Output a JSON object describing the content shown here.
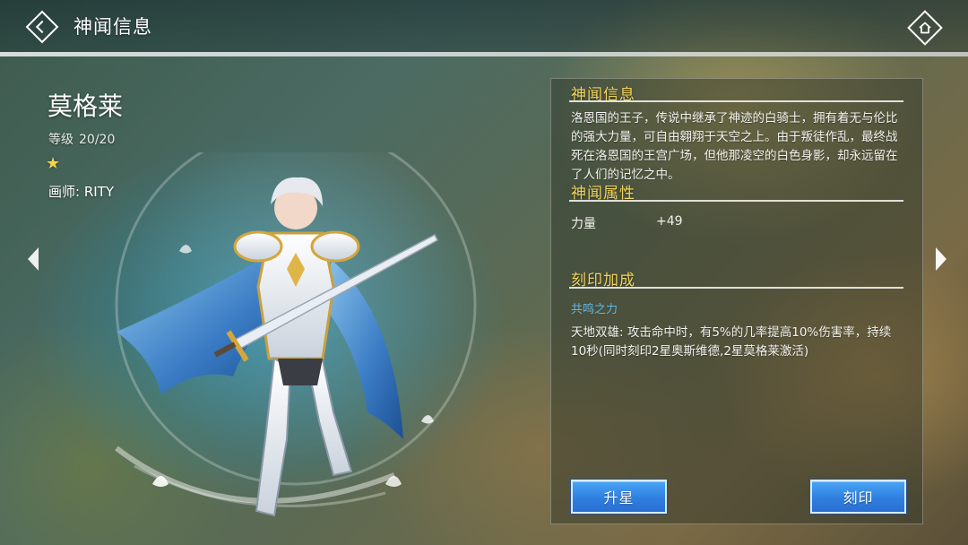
{
  "header": {
    "title": "神闻信息",
    "back_icon": "diamond-back-icon",
    "home_icon": "diamond-home-icon"
  },
  "hero": {
    "name": "莫格莱",
    "level_label": "等级",
    "level_value": "20/20",
    "stars": 1,
    "star_glyph": "★",
    "artist": "画师: RITY"
  },
  "panel": {
    "info": {
      "title": "神闻信息",
      "description": "洛恩国的王子，传说中继承了神迹的白骑士，拥有着无与伦比的强大力量，可自由翱翔于天空之上。由于叛徒作乱，最终战死在洛恩国的王宫广场，但他那凌空的白色身影，却永远留在了人们的记忆之中。"
    },
    "attributes": {
      "title": "神闻属性",
      "items": [
        {
          "name": "力量",
          "value": "+49"
        }
      ]
    },
    "seal": {
      "title": "刻印加成",
      "subtitle": "共鸣之力",
      "description": "天地双雄: 攻击命中时，有5%的几率提高10%伤害率，持续10秒(同时刻印2星奥斯维德,2星莫格莱激活)"
    },
    "buttons": {
      "upgrade": "升星",
      "engrave": "刻印"
    }
  },
  "colors": {
    "section_title": "#f2d35a",
    "subtitle": "#5fb6e8",
    "button": "#2f7fe0",
    "star": "#f4d34a"
  }
}
